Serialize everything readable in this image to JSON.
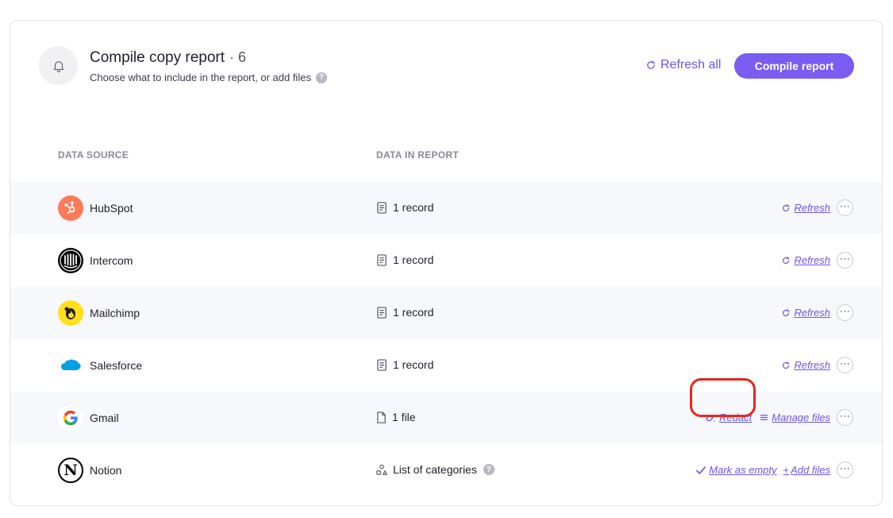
{
  "header": {
    "title": "Compile copy report",
    "count": "· 6",
    "subtitle": "Choose what to include in the report, or add files",
    "help": "?",
    "refresh_all_label": "Refresh all",
    "compile_label": "Compile report"
  },
  "columns": {
    "source": "DATA SOURCE",
    "data": "DATA IN REPORT"
  },
  "rows": [
    {
      "name": "HubSpot",
      "data": "1 record",
      "icon": "document-icon"
    },
    {
      "name": "Intercom",
      "data": "1 record",
      "icon": "document-icon"
    },
    {
      "name": "Mailchimp",
      "data": "1 record",
      "icon": "document-icon"
    },
    {
      "name": "Salesforce",
      "data": "1 record",
      "icon": "document-icon"
    },
    {
      "name": "Gmail",
      "data": "1 file",
      "icon": "file-icon"
    },
    {
      "name": "Notion",
      "data": "List of categories",
      "icon": "categories-icon",
      "help": "?"
    }
  ],
  "actions": {
    "refresh": "Refresh",
    "redact": "Redact",
    "manage_files": "Manage files",
    "mark_as_empty": "Mark as empty",
    "add_files": "Add files",
    "more": "···"
  },
  "colors": {
    "accent": "#7a5cf0",
    "link": "#6b57e6",
    "highlight": "#e5261c"
  }
}
